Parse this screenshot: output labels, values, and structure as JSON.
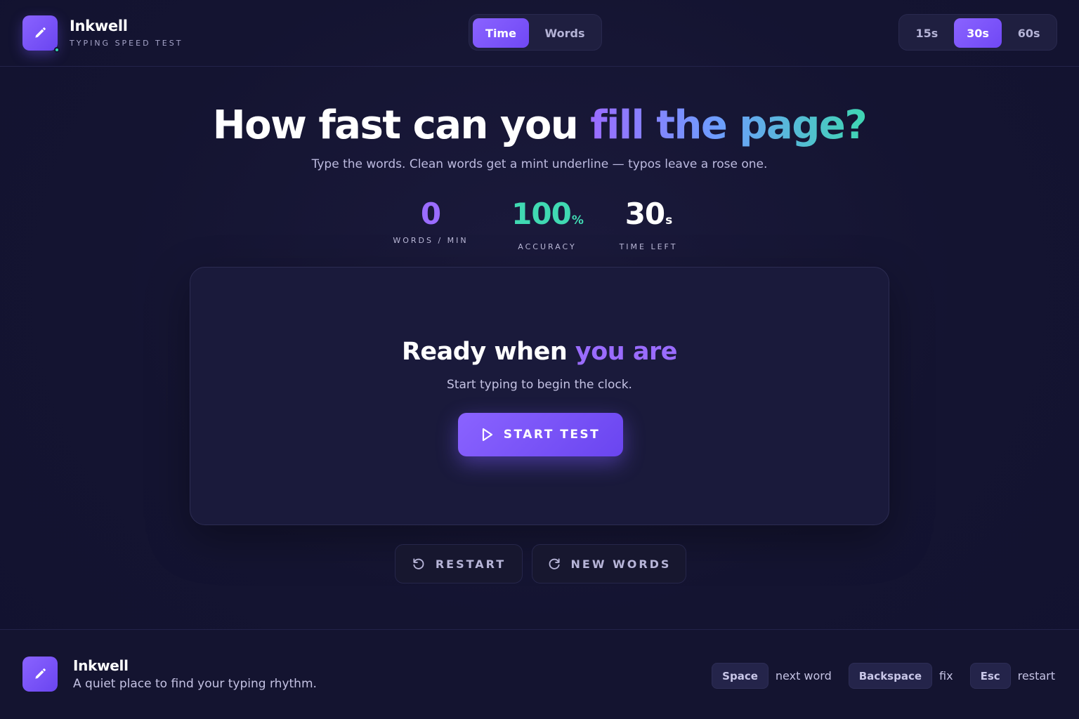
{
  "header": {
    "brand_name": "Inkwell",
    "brand_tagline": "TYPING SPEED TEST",
    "brand_icon": "pencil-icon",
    "mode_tabs": [
      {
        "label": "Time",
        "active": true
      },
      {
        "label": "Words",
        "active": false
      }
    ],
    "duration_tabs": [
      {
        "label": "15s",
        "active": false
      },
      {
        "label": "30s",
        "active": true
      },
      {
        "label": "60s",
        "active": false
      }
    ]
  },
  "hero": {
    "title_plain": "How fast can you ",
    "title_accent": "fill the page?",
    "subtitle": "Type the words. Clean words get a mint underline — typos leave a rose one."
  },
  "stats": {
    "wpm": {
      "value": "0",
      "label": "WORDS / MIN"
    },
    "accuracy": {
      "value": "100",
      "unit": "%",
      "label": "ACCURACY"
    },
    "time_left": {
      "value": "30",
      "unit": "s",
      "label": "TIME LEFT"
    }
  },
  "panel": {
    "title_plain": "Ready when ",
    "title_accent": "you are",
    "subtitle": "Start typing to begin the clock.",
    "start_label": "START TEST",
    "start_icon": "play-icon"
  },
  "actions": {
    "restart_label": "RESTART",
    "restart_icon": "restart-icon",
    "new_words_label": "NEW WORDS",
    "new_words_icon": "refresh-icon"
  },
  "footer": {
    "brand_name": "Inkwell",
    "tagline": "A quiet place to find your typing rhythm.",
    "shortcuts": [
      {
        "key": "Space",
        "hint": "next word"
      },
      {
        "key": "Backspace",
        "hint": "fix"
      },
      {
        "key": "Esc",
        "hint": "restart"
      }
    ]
  },
  "colors": {
    "background": "#151532",
    "accent_purple": "#8a63ff",
    "accent_mint": "#40d9b2",
    "panel": "#1a1a3b"
  }
}
